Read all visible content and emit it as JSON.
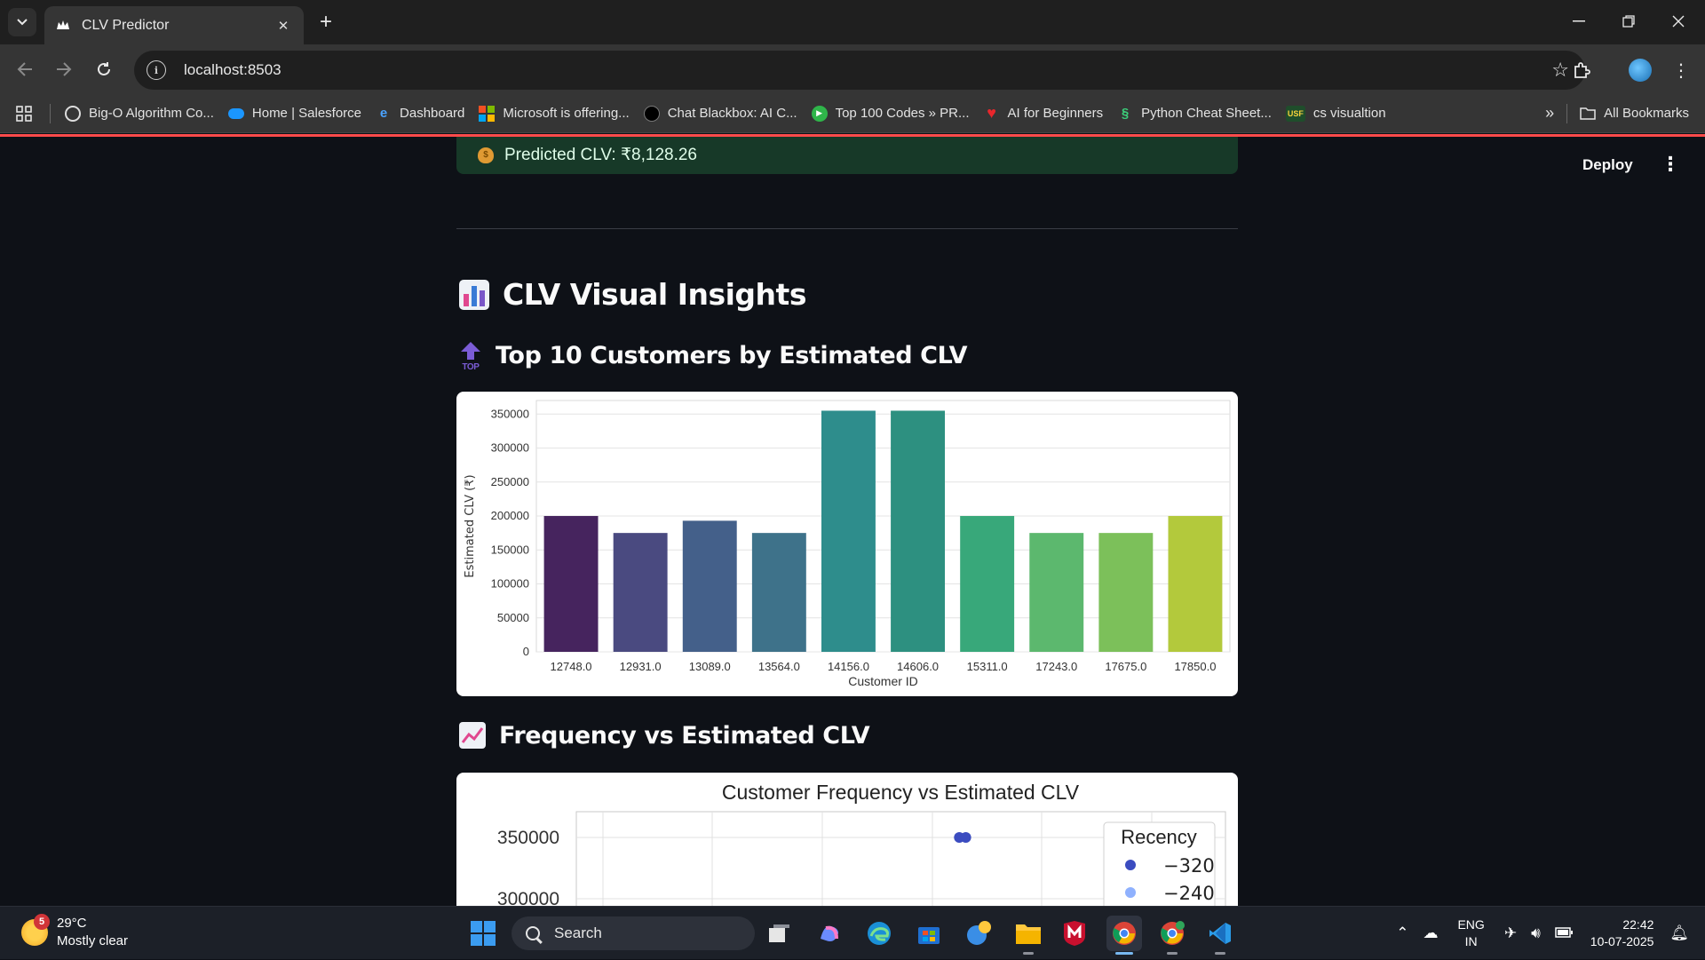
{
  "browser": {
    "tab_title": "CLV Predictor",
    "url": "localhost:8503",
    "bookmarks": [
      {
        "label": "Big-O Algorithm Co...",
        "icon": "globe-icon"
      },
      {
        "label": "Home | Salesforce",
        "icon": "salesforce-cloud-icon"
      },
      {
        "label": "Dashboard",
        "icon": "dashboard-icon"
      },
      {
        "label": "Microsoft is offering...",
        "icon": "microsoft-logo-icon"
      },
      {
        "label": "Chat Blackbox: AI C...",
        "icon": "blackbox-icon"
      },
      {
        "label": "Top 100 Codes » PR...",
        "icon": "play-icon"
      },
      {
        "label": "AI for Beginners",
        "icon": "heart-icon"
      },
      {
        "label": "Python Cheat Sheet...",
        "icon": "python-icon"
      },
      {
        "label": "cs visualtion",
        "icon": "usf-icon"
      }
    ],
    "all_bookmarks_label": "All Bookmarks"
  },
  "app": {
    "deploy_label": "Deploy",
    "success_message": "Predicted CLV: ₹8,128.26",
    "insights_heading": "CLV Visual Insights",
    "top10_heading": "Top 10 Customers by Estimated CLV",
    "freq_heading": "Frequency vs Estimated CLV",
    "colors": {
      "background": "#0e1117",
      "success_bg": "#173928",
      "success_text": "#dffde9"
    }
  },
  "chart_data": [
    {
      "type": "bar",
      "title": "",
      "xlabel": "Customer ID",
      "ylabel": "Estimated CLV (₹)",
      "categories": [
        "12748.0",
        "12931.0",
        "13089.0",
        "13564.0",
        "14156.0",
        "14606.0",
        "15311.0",
        "17243.0",
        "17675.0",
        "17850.0"
      ],
      "values": [
        200000,
        175000,
        193000,
        175000,
        355000,
        355000,
        200000,
        175000,
        175000,
        200000
      ],
      "ylim": [
        0,
        370000
      ],
      "yticks": [
        0,
        50000,
        100000,
        150000,
        200000,
        250000,
        300000,
        350000
      ],
      "ytick_labels": [
        "0",
        "50000",
        "100000",
        "150000",
        "200000",
        "250000",
        "300000",
        "350000"
      ],
      "colors": [
        "#46245e",
        "#4a4a80",
        "#44608a",
        "#3e728a",
        "#2e8d8c",
        "#2d9080",
        "#38a87a",
        "#5cb86e",
        "#7cc05a",
        "#b3c93c"
      ],
      "grid": true
    },
    {
      "type": "scatter",
      "title": "Customer Frequency vs Estimated CLV",
      "xlabel": "",
      "ylabel": "",
      "yticks_visible": [
        350000,
        300000
      ],
      "ytick_labels": [
        "350000",
        "300000"
      ],
      "points": [
        {
          "x": 0.59,
          "y": 350000,
          "recency": -320
        },
        {
          "x": 0.6,
          "y": 350000,
          "recency": -320
        }
      ],
      "legend": {
        "title": "Recency",
        "entries": [
          {
            "label": "−320",
            "color": "#3b4cc0"
          },
          {
            "label": "−240",
            "color": "#8fb1fe"
          }
        ],
        "position": "top-right"
      },
      "grid": true
    }
  ],
  "taskbar": {
    "temperature": "29°C",
    "weather": "Mostly clear",
    "weather_badge": "5",
    "search_placeholder": "Search",
    "lang_1": "ENG",
    "lang_2": "IN",
    "time": "22:42",
    "date": "10-07-2025"
  }
}
